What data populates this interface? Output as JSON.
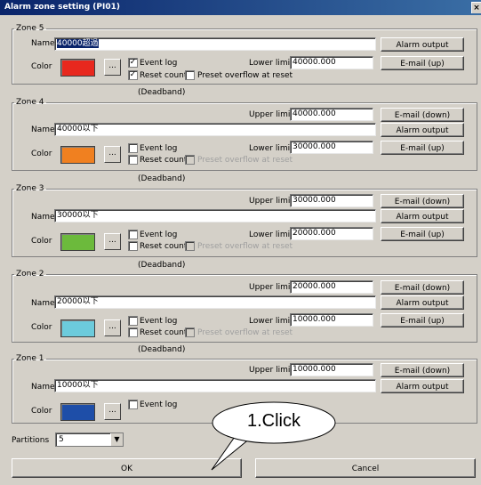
{
  "window": {
    "title": "Alarm zone setting (PI01)",
    "close_glyph": "×"
  },
  "labels": {
    "name": "Name",
    "color": "Color",
    "upper_limit": "Upper limit",
    "lower_limit": "Lower limit",
    "deadband": "(Deadband)",
    "event_log": "Event log",
    "reset_count": "Reset count",
    "preset_overflow": "Preset overflow at reset",
    "dots": "..."
  },
  "buttons": {
    "alarm_output": "Alarm output",
    "email_up": "E-mail (up)",
    "email_down": "E-mail (down)",
    "ok": "OK",
    "cancel": "Cancel"
  },
  "zones": [
    {
      "title": "Zone 5",
      "name": "40000超過",
      "color": "#e8281e",
      "lower": "40000.000",
      "event_log_checked": true,
      "reset_count_checked": true
    },
    {
      "title": "Zone 4",
      "name": "40000以下",
      "color": "#f08020",
      "upper": "40000.000",
      "lower": "30000.000"
    },
    {
      "title": "Zone 3",
      "name": "30000以下",
      "color": "#6cba3c",
      "upper": "30000.000",
      "lower": "20000.000"
    },
    {
      "title": "Zone 2",
      "name": "20000以下",
      "color": "#6ccbdc",
      "upper": "20000.000",
      "lower": "10000.000"
    },
    {
      "title": "Zone 1",
      "name": "10000以下",
      "color": "#1e4ea8",
      "upper": "10000.000"
    }
  ],
  "partitions": {
    "label": "Partitions",
    "value": "5"
  },
  "callout": {
    "text": "1.Click"
  },
  "icons": {
    "check": "✓",
    "dropdown": "chevron-down-icon"
  }
}
